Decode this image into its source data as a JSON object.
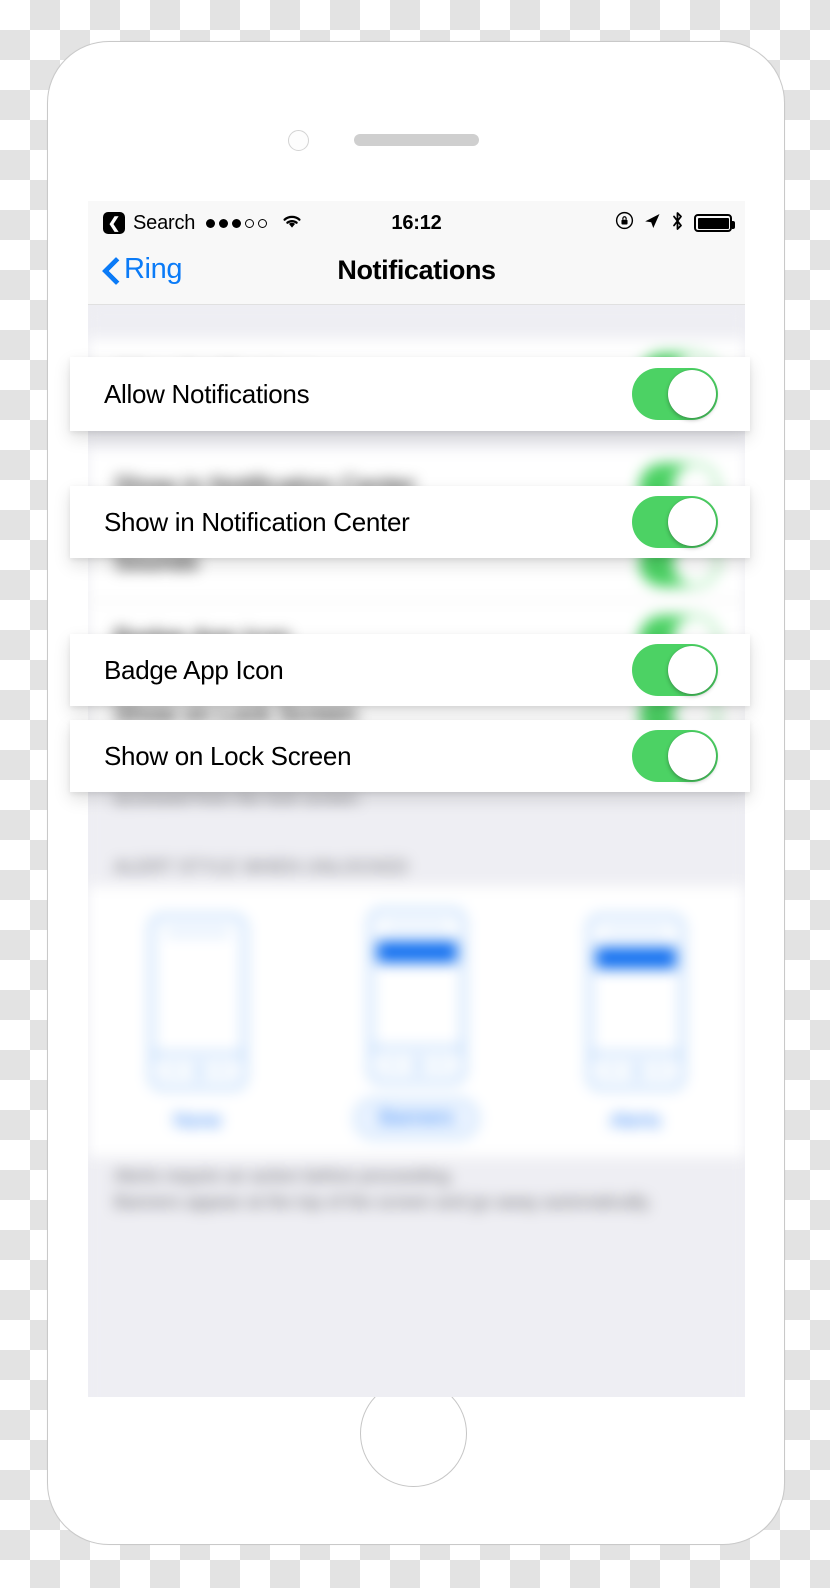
{
  "device": {
    "camera_icon": "camera-icon",
    "speaker_icon": "speaker-grille-icon",
    "home_button": "home-button"
  },
  "status_bar": {
    "back_chip_glyph": "❮",
    "back_chip_name": "back-to-search-icon",
    "carrier_label": "Search",
    "signal_dots": [
      true,
      true,
      true,
      false,
      false
    ],
    "wifi_icon": "wifi-icon",
    "time": "16:12",
    "right_icons": [
      "rotation-lock-icon",
      "location-arrow-icon",
      "bluetooth-icon",
      "battery-icon"
    ]
  },
  "nav_bar": {
    "back_label": "Ring",
    "back_icon": "chevron-left-icon",
    "title": "Notifications"
  },
  "foreground_rows": [
    {
      "id": "allow-notifications",
      "label": "Allow Notifications",
      "toggle": "on"
    },
    {
      "id": "show-in-notif-center",
      "label": "Show in Notification Center",
      "toggle": "on"
    },
    {
      "id": "badge-app-icon",
      "label": "Badge App Icon",
      "toggle": "on"
    },
    {
      "id": "show-on-lock-screen",
      "label": "Show on Lock Screen",
      "toggle": "on"
    }
  ],
  "background_rows": [
    {
      "id": "allow-notifications-bg",
      "label": "Allow Notifications",
      "toggle": "on"
    },
    {
      "id": "show-in-notif-center-bg",
      "label": "Show in Notification Center",
      "toggle": "on"
    },
    {
      "id": "sounds",
      "label": "Sounds",
      "toggle": "on"
    },
    {
      "id": "badge-app-icon-bg",
      "label": "Badge App Icon",
      "toggle": "on"
    },
    {
      "id": "show-on-lock-screen-bg",
      "label": "Show on Lock Screen",
      "toggle": "on"
    }
  ],
  "lock_screen_footer": "Show notifications on the lock screen, and in Notification Center when it is accessed from the lock screen.",
  "alert_style": {
    "section_header": "ALERT STYLE WHEN UNLOCKED",
    "options": [
      {
        "id": "none",
        "label": "None",
        "selected": false,
        "has_banner": false
      },
      {
        "id": "banners",
        "label": "Banners",
        "selected": true,
        "has_banner": true
      },
      {
        "id": "alerts",
        "label": "Alerts",
        "selected": false,
        "has_banner": true
      }
    ],
    "footer_line_1": "Alerts require an action before proceeding.",
    "footer_line_2": "Banners appear at the top of the screen and go away automatically."
  },
  "colors": {
    "ios_green": "#4cd264",
    "ios_blue": "#0b7bf7",
    "screen_bg": "#eeeef3",
    "bar_bg": "#f8f8f8",
    "glyph_blue": "#bcd9fb",
    "banner_blue": "#1471f0"
  }
}
